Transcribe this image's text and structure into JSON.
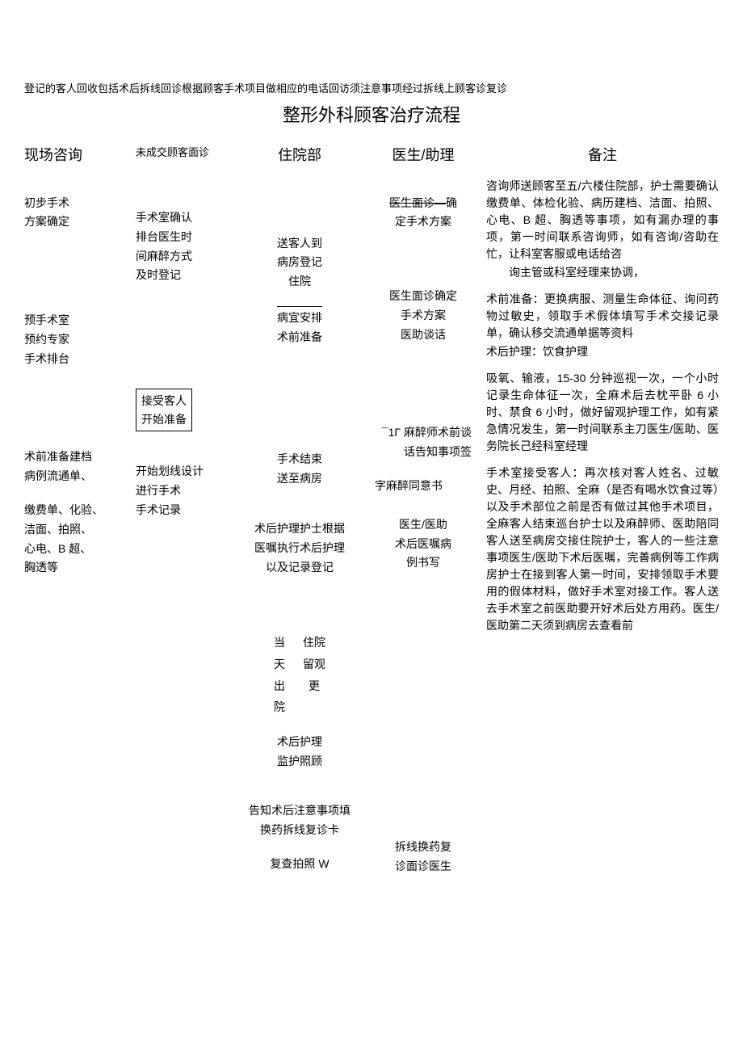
{
  "top_line": "登记的客人回收包括术后拆线回诊根据顾客手术项目做相应的电话回访须注意事项经过拆线上顾客诊复诊",
  "title": "整形外科顾客治疗流程",
  "columns": {
    "c1": {
      "head": "现场咨询",
      "b1": "初步手术\n方案确定",
      "b2": "预手术室\n预约专家\n手术排台",
      "b3": "术前准备建档\n病例流通单、",
      "b4": "缴费单、化验、\n洁面、拍照、\n心电、B 超、\n胸透等"
    },
    "c2": {
      "small": "未成交顾客面诊",
      "b1": "手术室确认\n排台医生时\n间麻醉方式\n及时登记",
      "b2": "接受客人\n开始准备",
      "b3": "开始划线设计\n进行手术\n手术记录"
    },
    "c3": {
      "head": "住院部",
      "b1": "送客人到\n病房登记\n住院",
      "b2": "病宜安排\n术前准备",
      "b3": "手术结束\n送至病房",
      "b4": "术后护理护士根据\n医嘱执行术后护理\n以及记录登记",
      "gridL": "当\n天\n出\n院",
      "gridR": "住院\n留观\n更",
      "b5": "术后护理\n监护照顾",
      "b6": "告知术后注意事项填\n换药拆线复诊卡",
      "b7": "复查拍照    W"
    },
    "c4": {
      "head": "医生/助理",
      "b1_s": "医生面诊—",
      "b1_r": "确\n定手术方案",
      "b2": "医生面诊确定\n手术方案\n医助谈话",
      "b3a": "¯1Γ",
      "b3b": "麻醉师术前谈话告知事项签",
      "b4": "字麻醉同意书",
      "b5": "医生/医助\n术后医嘱病\n例书写",
      "b6": "拆线换药复\n诊面诊医生"
    },
    "c5": {
      "head": "备注",
      "n1": [
        "咨询师送顾客至五/六楼住院部，护士需要确认缴费单、体检化验、病历建档、洁面、拍照、心电、B 超、胸透等事项，如有漏办理的事项，第一时间联系咨询师，如有咨询/咨助在忙，让科室客服或电话给咨",
        "询主管或科室经理来协调，"
      ],
      "n2": [
        "术前准备：更换病服、测量生命体征、询问药物过敏史，领取手术假体填写手术交接记录单，确认移交流通单据等资料",
        "术后护理：饮食护理"
      ],
      "n3": [
        "吸氧、输液，15-30 分钟巡视一次，一个小时记录生命体征一次，全麻术后去枕平卧 6 小时、禁食 6 小时，做好留观护理工作，如有紧急情况发生，第一时间联系主刀医生/医助、医务院长己经科室经理"
      ],
      "n4": [
        "手术室接受客人：再次核对客人姓名、过敏史、月经、拍照、全麻（是否有喝水饮食过等）以及手术部位之前是否有做过其他手术项目，全麻客人结束巡台护士以及麻醉师、医助陪同客人送至病房交接住院护士，客人的一些注意事项医生/医助下术后医嘱，完善病例等工作病房护士在接到客人第一时间，安排领取手术要用的假体材料，做好手术室对接工作。客人送去手术室之前医助要开好术后处方用药。医生/医助第二天须到病房去查看前"
      ]
    }
  }
}
